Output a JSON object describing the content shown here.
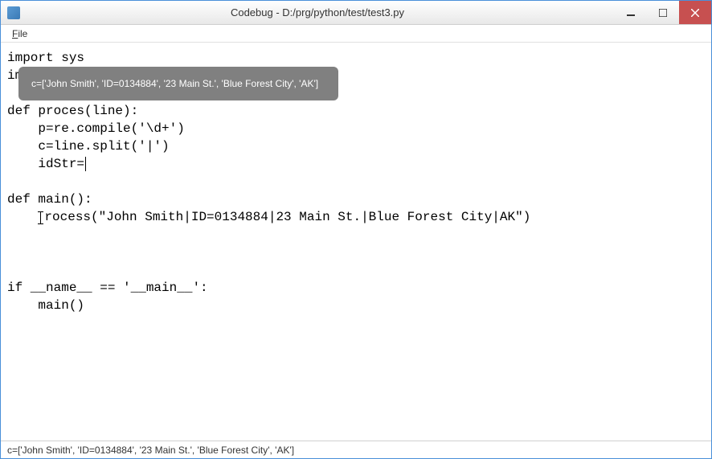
{
  "window": {
    "title": "Codebug - D:/prg/python/test/test3.py"
  },
  "menu": {
    "file": "File"
  },
  "tooltip": {
    "text": "c=['John Smith', 'ID=0134884', '23 Main St.', 'Blue Forest City', 'AK']"
  },
  "code": {
    "line1": "import sys",
    "line2_partial": "im",
    "line3": "",
    "line4_a": "def proces",
    "line4_b": "(line):",
    "line5": "    p=re.compile('\\d+')",
    "line6": "    c=line.split('|')",
    "line7": "    idStr=",
    "line8": "",
    "line9": "def main():",
    "line10_a": "    ",
    "line10_b": "rocess(\"John Smith|ID=0134884|23 Main St.|Blue Forest City|AK\")",
    "line11": "",
    "line12": "",
    "line13": "",
    "line14": "if __name__ == '__main__':",
    "line15": "    main()"
  },
  "statusbar": {
    "text": "c=['John Smith', 'ID=0134884', '23 Main St.', 'Blue Forest City', 'AK']"
  }
}
